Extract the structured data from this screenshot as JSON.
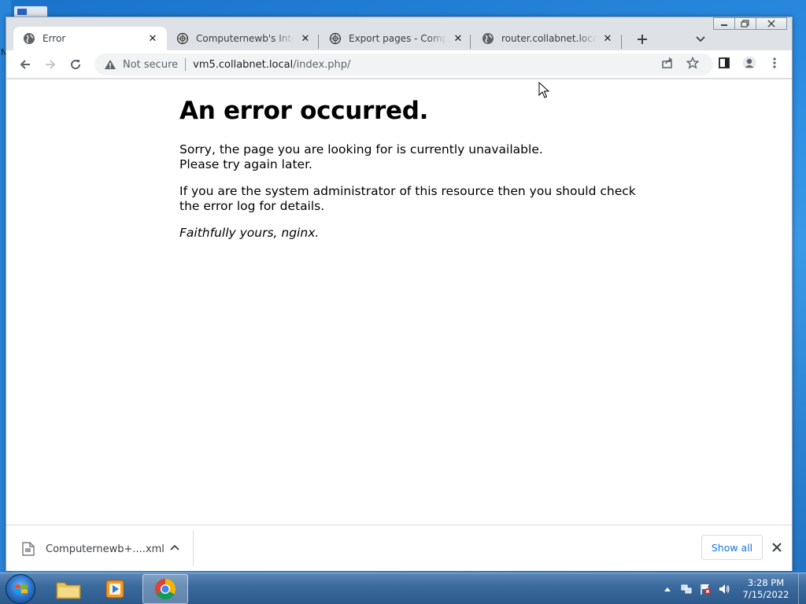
{
  "browser": {
    "tabs": [
      {
        "title": "Error",
        "icon": "globe-icon",
        "active": true
      },
      {
        "title": "Computernewb's Interne",
        "icon": "wiki-icon",
        "active": false
      },
      {
        "title": "Export pages - Compute",
        "icon": "wiki-icon",
        "active": false
      },
      {
        "title": "router.collabnet.local/bl",
        "icon": "globe-icon",
        "active": false
      }
    ],
    "security_label": "Not secure",
    "url_host": "vm5.collabnet.local",
    "url_path": "/index.php/"
  },
  "page": {
    "heading": "An error occurred.",
    "line1": "Sorry, the page you are looking for is currently unavailable.",
    "line2": "Please try again later.",
    "admin_note": "If you are the system administrator of this resource then you should check the error log for details.",
    "signature": "Faithfully yours, nginx."
  },
  "downloads": {
    "file_name": "Computernewb+....xml",
    "show_all_label": "Show all"
  },
  "taskbar": {
    "time": "3:28 PM",
    "date": "7/15/2022"
  },
  "colors": {
    "accent": "#1a73e8",
    "desktop": "#2b8be0",
    "taskbar": "#3b6a9e"
  }
}
